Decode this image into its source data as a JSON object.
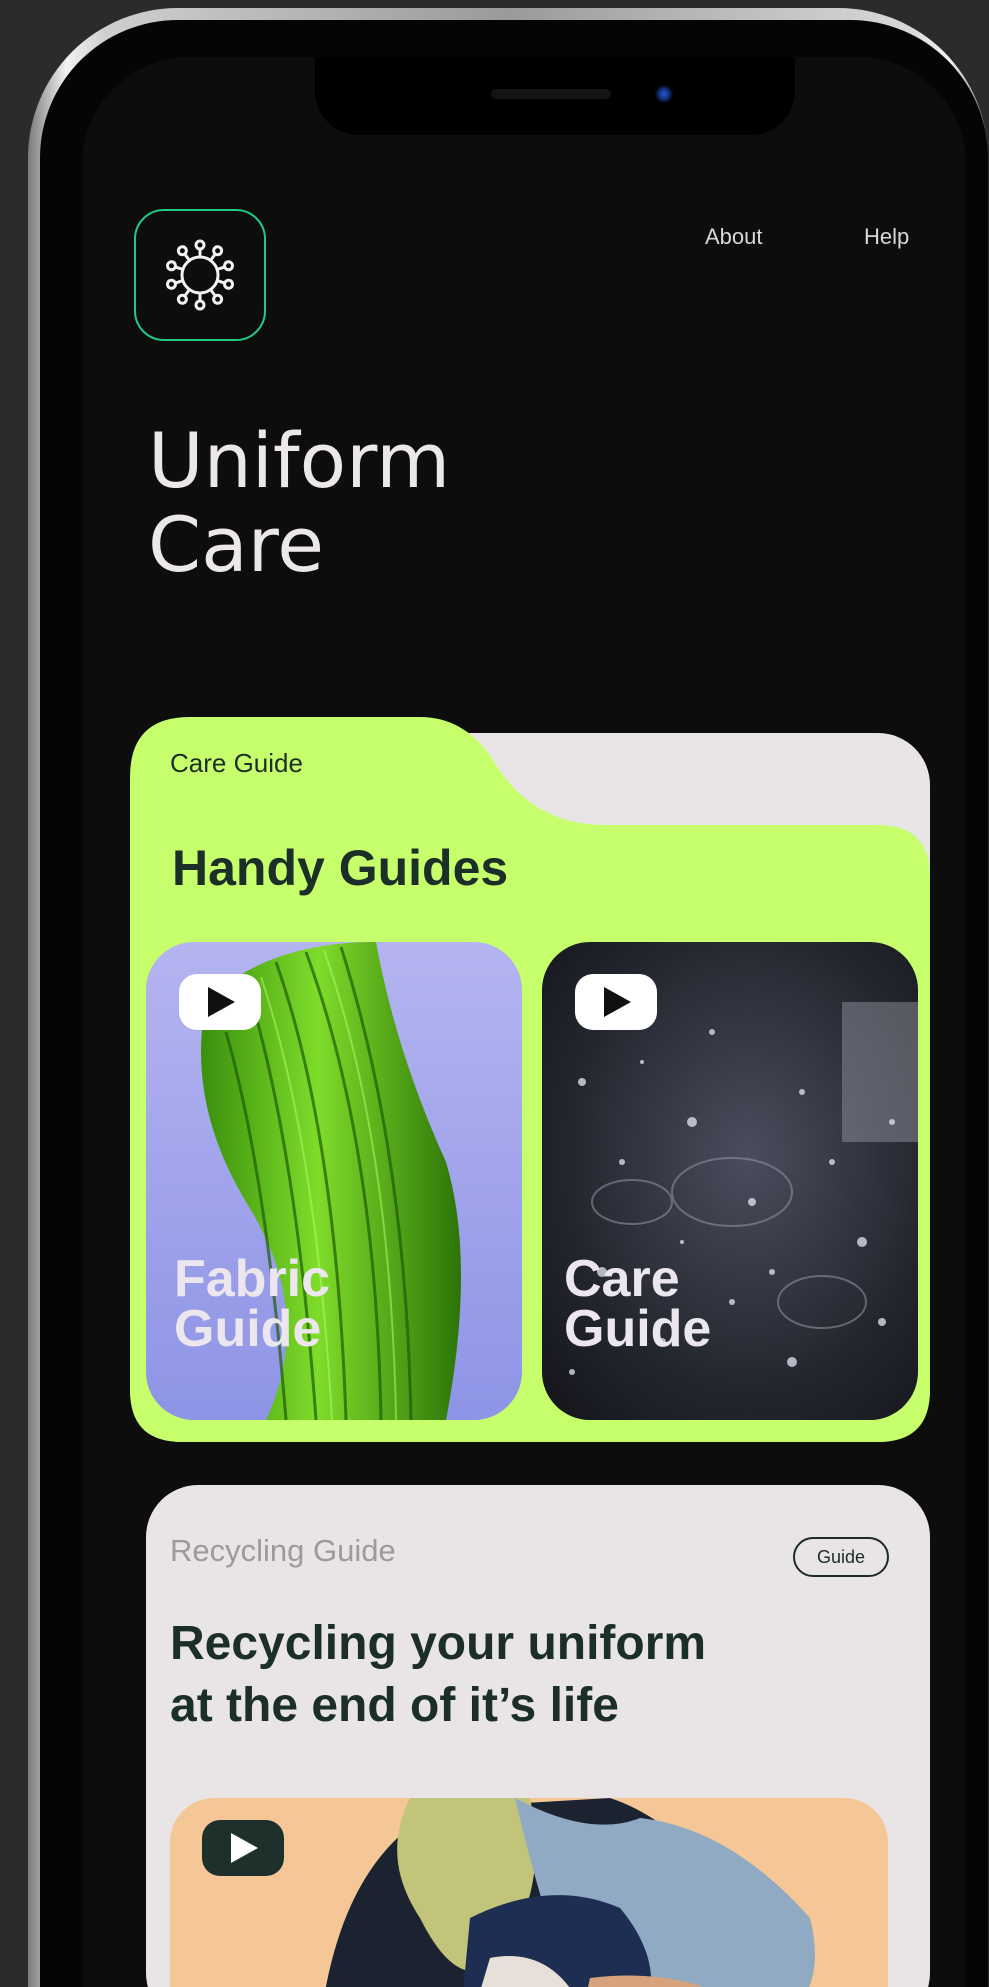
{
  "nav": {
    "about": "About",
    "help": "Help"
  },
  "hero": {
    "title": "Uniform\nCare"
  },
  "care_guide": {
    "tab_label": "Care Guide",
    "heading": "Handy Guides",
    "videos": [
      {
        "title": "Fabric\nGuide",
        "icon": "play-icon"
      },
      {
        "title": "Care\nGuide",
        "icon": "play-icon"
      }
    ]
  },
  "recycling": {
    "label": "Recycling Guide",
    "pill": "Guide",
    "heading": "Recycling your uniform\nat the end of it’s life",
    "icon": "play-icon"
  },
  "colors": {
    "accent_lime": "#c6ff6b",
    "logo_border": "#22c983",
    "card_light": "#e9e5e7",
    "text_dark": "#1c2e28",
    "screen_bg": "#0d0d0d"
  }
}
